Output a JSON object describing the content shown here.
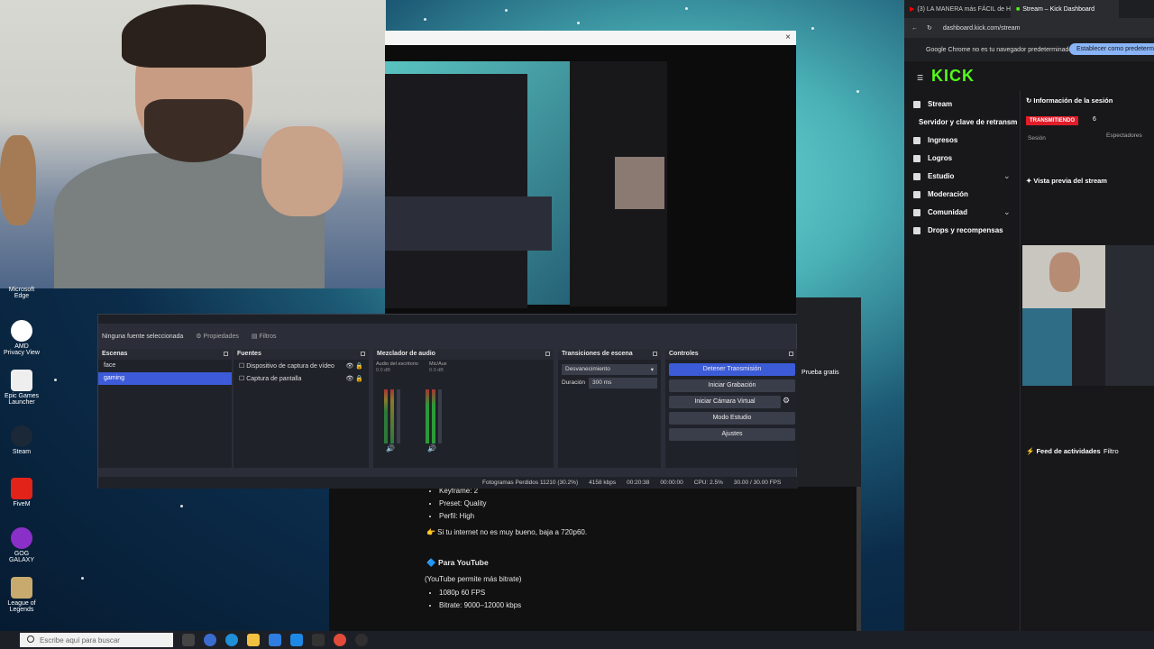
{
  "desktop": {
    "icons": [
      {
        "label": "Microsoft Edge"
      },
      {
        "label": "AMD Privacy View"
      },
      {
        "label": "Epic Games Launcher"
      },
      {
        "label": "Steam"
      },
      {
        "label": "FiveM"
      },
      {
        "label": "GOG GALAXY"
      },
      {
        "label": "League of Legends"
      }
    ]
  },
  "taskbar": {
    "search_placeholder": "Escribe aquí para buscar"
  },
  "document": {
    "lines_top": [
      "Keyframe: 2",
      "Preset: Quality",
      "Perfil: High"
    ],
    "tip": "👉 Si tu internet no es muy bueno, baja a 720p60.",
    "youtube_title": "🔷 Para YouTube",
    "youtube_note": "(YouTube permite más bitrate)",
    "youtube_items": [
      "1080p 60 FPS",
      "Bitrate: 9000–12000 kbps"
    ]
  },
  "obs": {
    "toolbar": {
      "no_source": "Ninguna fuente seleccionada",
      "properties": "Propiedades",
      "filters": "Filtros"
    },
    "scenes": {
      "title": "Escenas",
      "items": [
        "face",
        "gaming"
      ],
      "selected": "gaming"
    },
    "sources": {
      "title": "Fuentes",
      "items": [
        "Dispositivo de captura de vídeo",
        "Captura de pantalla"
      ]
    },
    "mixer": {
      "title": "Mezclador de audio",
      "ch1": "Audio del escritorio",
      "ch1_db": "0.0 dB",
      "ch2": "Mic/Aux",
      "ch2_db": "0.0 dB"
    },
    "transitions": {
      "title": "Transiciones de escena",
      "selected": "Desvanecimiento",
      "duration_label": "Duración",
      "duration": "300 ms"
    },
    "controls": {
      "title": "Controles",
      "stop_stream": "Detener Transmisión",
      "start_rec": "Iniciar Grabación",
      "virtual_cam": "Iniciar Cámara Virtual",
      "studio": "Modo Estudio",
      "settings": "Ajustes"
    },
    "status": {
      "dropped": "Fotogramas Perdidos 11210 (30.2%)",
      "bitrate": "4158 kbps",
      "live_time": "00:20:38",
      "rec_time": "00:00:00",
      "cpu": "CPU: 2.5%",
      "fps": "30.00 / 30.00 FPS"
    }
  },
  "chrome": {
    "tabs": [
      {
        "label": "(3) LA MANERA más FÁCIL de H",
        "active": false
      },
      {
        "label": "Stream – Kick Dashboard",
        "active": true
      }
    ],
    "url": "dashboard.kick.com/stream",
    "infobar_text": "Google Chrome no es tu navegador predeterminado",
    "infobar_button": "Establecer como predeterm",
    "behind_text": "Prueba gratis"
  },
  "kick": {
    "logo": "KICK",
    "nav": [
      "Stream",
      "Servidor y clave de retransm",
      "Ingresos",
      "Logros",
      "Estudio",
      "Moderación",
      "Comunidad",
      "Drops y recompensas"
    ],
    "session_title": "Información de la sesión",
    "live_badge": "TRANSMITIENDO",
    "viewers": "6",
    "session_label": "Sesión",
    "viewers_label": "Espectadores",
    "preview_title": "Vista previa del stream",
    "feed_title": "Feed de actividades",
    "filter": "Filtro"
  },
  "colors": {
    "obs_accent": "#3c5bd7",
    "kick_green": "#53fc18",
    "live_red": "#e11d2a"
  }
}
